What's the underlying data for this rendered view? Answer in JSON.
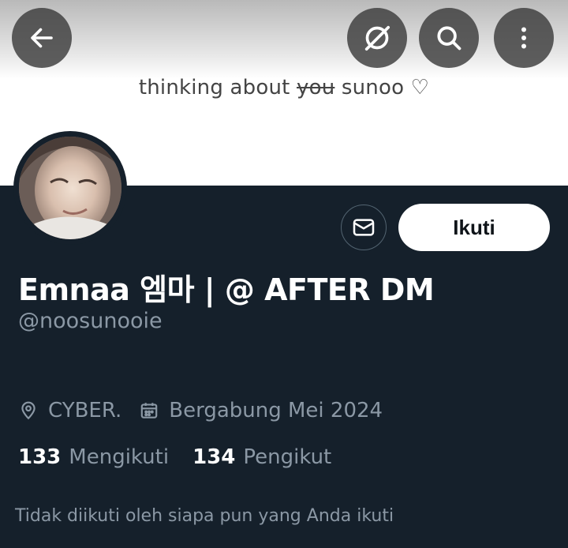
{
  "banner": {
    "text_before": "thinking about ",
    "text_struck": "you",
    "text_after": " sunoo ♡"
  },
  "header": {
    "back_icon": "arrow-left-icon",
    "grok_icon": "grok-icon",
    "search_icon": "search-icon",
    "more_icon": "more-vertical-icon"
  },
  "profile": {
    "display_name": "Emnaa 엠마 | @ AFTER DM",
    "handle": "@noosunooie",
    "location": "CYBER.",
    "joined": "Bergabung Mei 2024",
    "following_count": "133",
    "following_label": "Mengikuti",
    "followers_count": "134",
    "followers_label": "Pengikut",
    "followed_by_note": "Tidak diikuti oleh siapa pun yang Anda ikuti"
  },
  "actions": {
    "message_icon": "envelope-icon",
    "follow_label": "Ikuti"
  },
  "colors": {
    "background": "#15202b",
    "secondary_text": "#8b98a5",
    "button_bg": "#ffffff",
    "button_text": "#0f1419"
  }
}
